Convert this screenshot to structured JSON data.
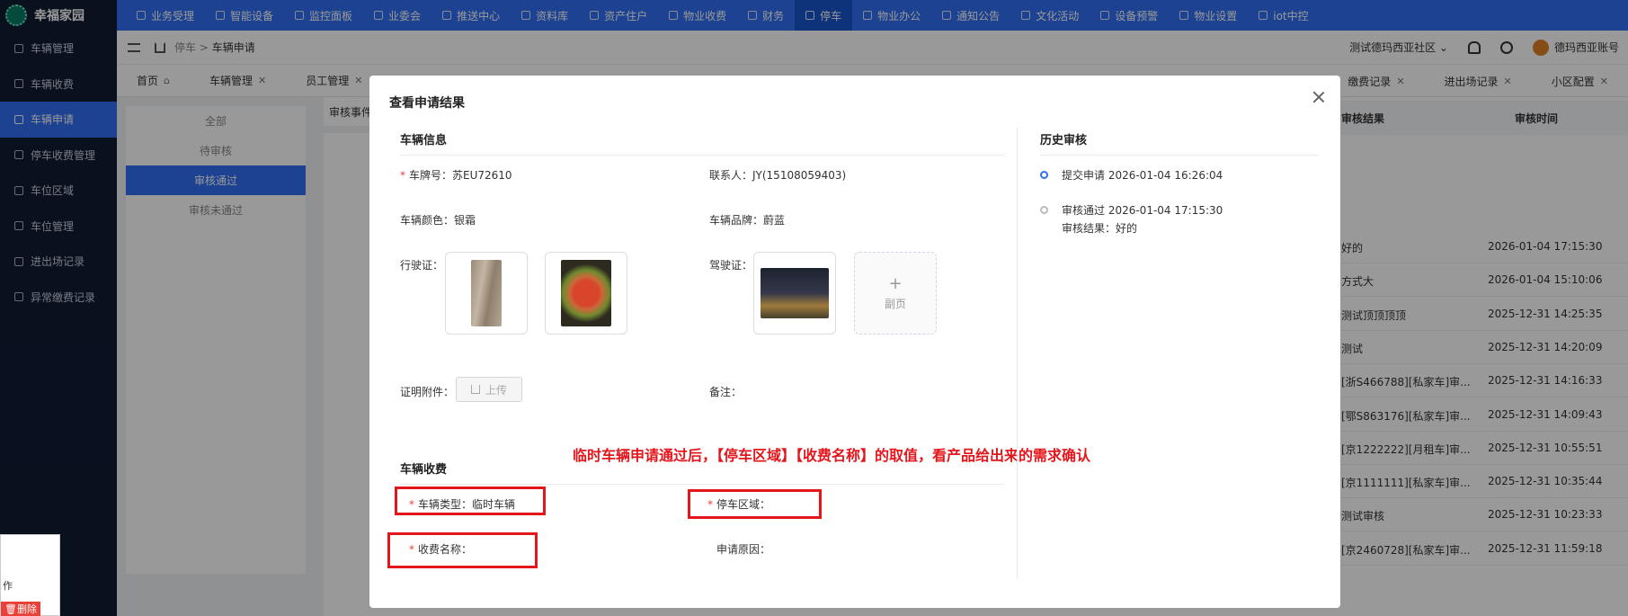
{
  "app": {
    "name": "幸福家园"
  },
  "topnav": [
    {
      "label": "业务受理"
    },
    {
      "label": "智能设备"
    },
    {
      "label": "监控面板"
    },
    {
      "label": "业委会"
    },
    {
      "label": "推送中心"
    },
    {
      "label": "资料库"
    },
    {
      "label": "资产住户"
    },
    {
      "label": "物业收费"
    },
    {
      "label": "财务"
    },
    {
      "label": "停车",
      "active": true
    },
    {
      "label": "物业办公"
    },
    {
      "label": "通知公告"
    },
    {
      "label": "文化活动"
    },
    {
      "label": "设备预警"
    },
    {
      "label": "物业设置"
    },
    {
      "label": "iot中控"
    }
  ],
  "sidebar": [
    {
      "label": "车辆管理"
    },
    {
      "label": "车辆收费"
    },
    {
      "label": "车辆申请",
      "active": true
    },
    {
      "label": "停车收费管理"
    },
    {
      "label": "车位区域"
    },
    {
      "label": "车位管理"
    },
    {
      "label": "进出场记录"
    },
    {
      "label": "异常缴费记录"
    }
  ],
  "header": {
    "breadcrumb_parent": "停车",
    "breadcrumb_sep": ">",
    "breadcrumb_current": "车辆申请",
    "community": "测试德玛西亚社区",
    "user": "德玛西亚账号"
  },
  "tabs": [
    {
      "label": "首页"
    },
    {
      "label": "车辆管理"
    },
    {
      "label": "员工管理"
    }
  ],
  "tabs_right": [
    {
      "label": "缴费记录"
    },
    {
      "label": "进出场记录"
    },
    {
      "label": "小区配置"
    }
  ],
  "filter": [
    "全部",
    "待审核",
    "审核通过",
    "审核未通过"
  ],
  "panel_label": "审核事件",
  "table": {
    "col_result": "审核结果",
    "col_time": "审核时间",
    "rows": [
      {
        "result": "好的",
        "time": "2026-01-04 17:15:30"
      },
      {
        "result": "方式大",
        "time": "2026-01-04 15:10:06"
      },
      {
        "result": "测试顶顶顶顶",
        "time": "2025-12-31 14:25:35"
      },
      {
        "result": "测试",
        "time": "2025-12-31 14:20:09"
      },
      {
        "result": "[浙S466788][私家车]审...",
        "time": "2025-12-31 14:16:33"
      },
      {
        "result": "[鄂S863176][私家车]审...",
        "time": "2025-12-31 14:09:43"
      },
      {
        "result": "[京1222222][月租车]审...",
        "time": "2025-12-31 10:55:51"
      },
      {
        "result": "[京1111111][私家车]审...",
        "time": "2025-12-31 10:35:44"
      },
      {
        "result": "测试审核",
        "time": "2025-12-31 10:23:33"
      },
      {
        "result": "[京2460728][私家车]审...",
        "time": "2025-12-31 11:59:18"
      }
    ]
  },
  "mini_popup": {
    "text": "作",
    "button": "删除"
  },
  "modal": {
    "title": "查看申请结果",
    "vehicle_info_title": "车辆信息",
    "plate": "车牌号：苏EU72610",
    "contact": "联系人：JY(15108059403)",
    "color": "车辆颜色：银霜",
    "brand": "车辆品牌：蔚蓝",
    "driving_license": "行驶证：",
    "driver_license": "驾驶证：",
    "back_page": "副页",
    "attachment": "证明附件：",
    "upload": "上传",
    "remark": "备注：",
    "fee_title": "车辆收费",
    "vehicle_type": "车辆类型：临时车辆",
    "parking_area": "停车区域：",
    "fee_name": "收费名称：",
    "reason": "申请原因：",
    "annotation": "临时车辆申请通过后，【停车区域】【收费名称】的取值，看产品给出来的需求确认",
    "history_title": "历史审核",
    "history": [
      {
        "line1": "提交申请 2026-01-04 16:26:04",
        "line2": ""
      },
      {
        "line1": "审核通过 2026-01-04 17:15:30",
        "line2": "审核结果：好的"
      }
    ]
  }
}
